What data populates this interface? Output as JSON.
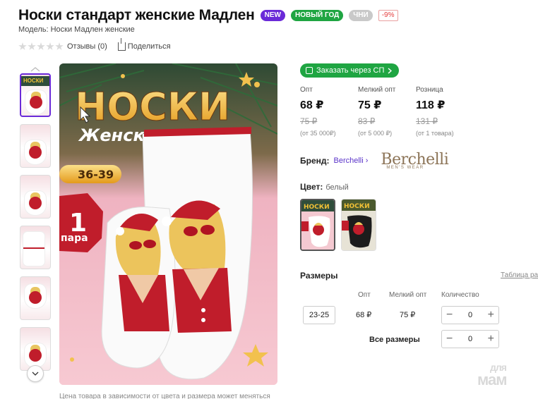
{
  "product": {
    "title": "Носки стандарт женские Мадлен",
    "badges": {
      "new": "NEW",
      "new_year": "НОВЫЙ ГОД",
      "chni": "ЧНИ",
      "discount": "-9%"
    },
    "model": "Модель: Носки Мадлен женские"
  },
  "rating": {
    "reviews": "Отзывы (0)",
    "share": "Поделиться"
  },
  "gallery": {
    "thumb_text": "НОСКИ",
    "image": {
      "title": "НОСКИ",
      "subtitle": "Женские",
      "size": "36-39",
      "count": "1",
      "count_label": "пара"
    }
  },
  "order": {
    "sp_button": "Заказать через СП"
  },
  "prices": [
    {
      "label": "Опт",
      "price": "68 ₽",
      "old": "75 ₽",
      "from": "(от 35 000₽)"
    },
    {
      "label": "Мелкий опт",
      "price": "75 ₽",
      "old": "83 ₽",
      "from": "(от 5 000 ₽)"
    },
    {
      "label": "Розница",
      "price": "118 ₽",
      "old": "131 ₽",
      "from": "(от 1 товара)"
    }
  ],
  "brand": {
    "label": "Бренд:",
    "name": "Berchelli",
    "logo_text": "Berchelli",
    "logo_sub": "MEN'S WEAR"
  },
  "color": {
    "label": "Цвет:",
    "value": "белый"
  },
  "sizes": {
    "title": "Размеры",
    "table_link": "Таблица раз",
    "headers": {
      "opt": "Опт",
      "small_opt": "Мелкий опт",
      "qty": "Количество"
    },
    "rows": [
      {
        "size": "23-25",
        "opt": "68 ₽",
        "small_opt": "75 ₽",
        "qty": "0"
      }
    ],
    "all_sizes": "Все размеры",
    "all_qty": "0"
  },
  "note": "Цена товара в зависимости от цвета и размера может меняться",
  "watermark": {
    "top": "для",
    "bottom": "мам"
  },
  "colors": {
    "accent": "#6a2ad8",
    "green": "#1fa542",
    "red": "#c01d2b"
  }
}
